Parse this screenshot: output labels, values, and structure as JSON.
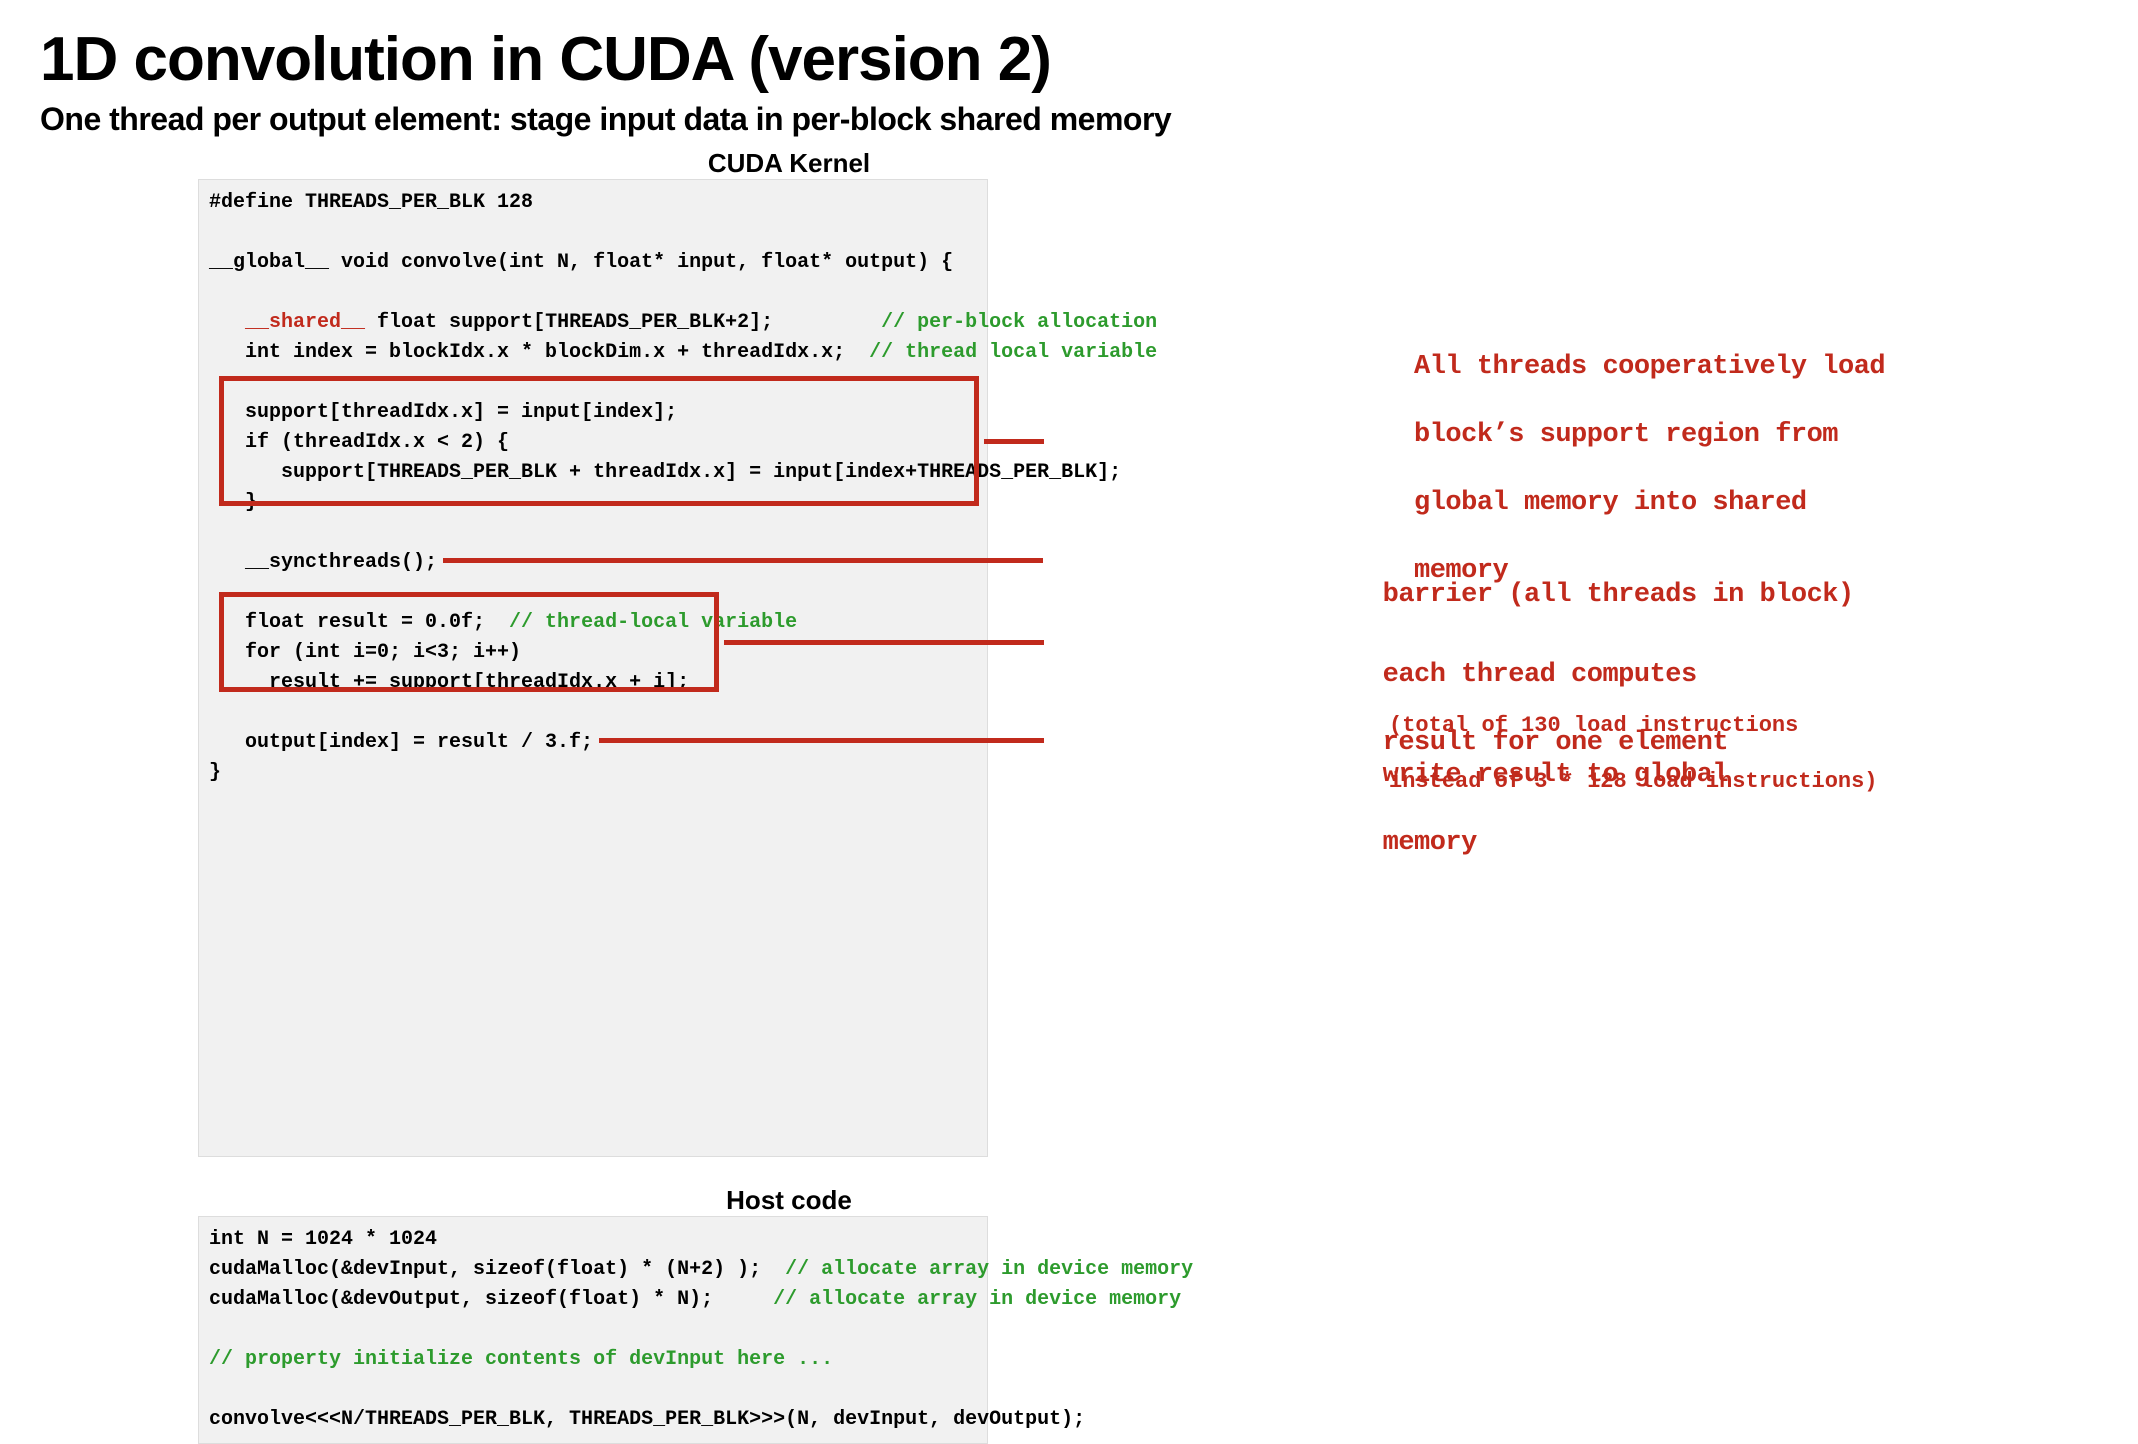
{
  "title": "1D convolution in CUDA (version 2)",
  "subtitle": "One thread per output element: stage input data in per-block shared memory",
  "labels": {
    "kernel": "CUDA Kernel",
    "host": "Host code"
  },
  "kernel": {
    "l1": "#define THREADS_PER_BLK 128",
    "l2": "",
    "l3": "__global__ void convolve(int N, float* input, float* output) {",
    "l4": "",
    "l5a": "   ",
    "l5b": "__shared__",
    "l5c": " float support[THREADS_PER_BLK+2];",
    "l5d": "         // per-block allocation",
    "l6a": "   int index = blockIdx.x * blockDim.x + threadIdx.x;",
    "l6b": "  // thread local variable",
    "l7": "",
    "l8": "   support[threadIdx.x] = input[index];",
    "l9": "   if (threadIdx.x < 2) {",
    "l10": "      support[THREADS_PER_BLK + threadIdx.x] = input[index+THREADS_PER_BLK];",
    "l11": "   }",
    "l12": "",
    "l13": "   __syncthreads();",
    "l14": "",
    "l15a": "   float result = 0.0f;",
    "l15b": "  // thread-local variable",
    "l16": "   for (int i=0; i<3; i++) ",
    "l17": "     result += support[threadIdx.x + i];",
    "l18": "",
    "l19": "   output[index] = result / 3.f;",
    "l20": "}"
  },
  "host": {
    "l1": "int N = 1024 * 1024",
    "l2a": "cudaMalloc(&devInput, sizeof(float) * (N+2) );",
    "l2b": "  // allocate array in device memory",
    "l3a": "cudaMalloc(&devOutput, sizeof(float) * N);",
    "l3b": "     // allocate array in device memory",
    "l4": "",
    "l5": "// property initialize contents of devInput here ...",
    "l6": "",
    "l7": "convolve<<<N/THREADS_PER_BLK, THREADS_PER_BLK>>>(N, devInput, devOutput);"
  },
  "anno": {
    "a1_l1": "All threads cooperatively load",
    "a1_l2": "block’s support region from",
    "a1_l3": "global memory into shared",
    "a1_l4": "memory",
    "a1_s1": "(total of 130 load instructions",
    "a1_s2": "instead of 3 * 128 load instructions)",
    "a2": "barrier (all threads in block)",
    "a3_l1": "each thread computes",
    "a3_l2": "result for one element",
    "a4_l1": "write result to global",
    "a4_l2": "memory"
  }
}
